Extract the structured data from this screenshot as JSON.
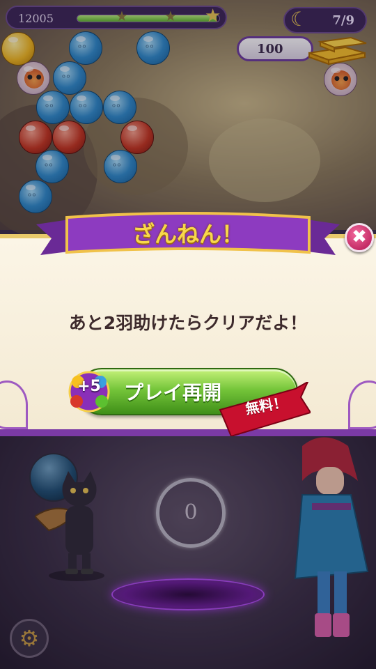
{
  "hud": {
    "score": "12005",
    "star_progress": 0.98,
    "stars_total": 3,
    "rescued_counter": "7/9",
    "gold_amount": "100"
  },
  "dialog": {
    "title": "ざんねん！",
    "message": "あと2羽助けたらクリアだよ！",
    "bonus_text": "+5",
    "replay_button_label": "プレイ再開",
    "free_tag": "無料！",
    "close_symbol": "✖"
  },
  "play_area": {
    "shots_remaining": "0"
  },
  "icons": {
    "close": "close-icon",
    "settings": "gear-icon",
    "moon": "moon-icon",
    "star": "star-icon"
  },
  "colors": {
    "accent_purple": "#7b3aa5",
    "title_gold": "#f8d84a",
    "button_green": "#75c53a",
    "free_red": "#c8102e",
    "close_pink": "#d62a6e"
  }
}
